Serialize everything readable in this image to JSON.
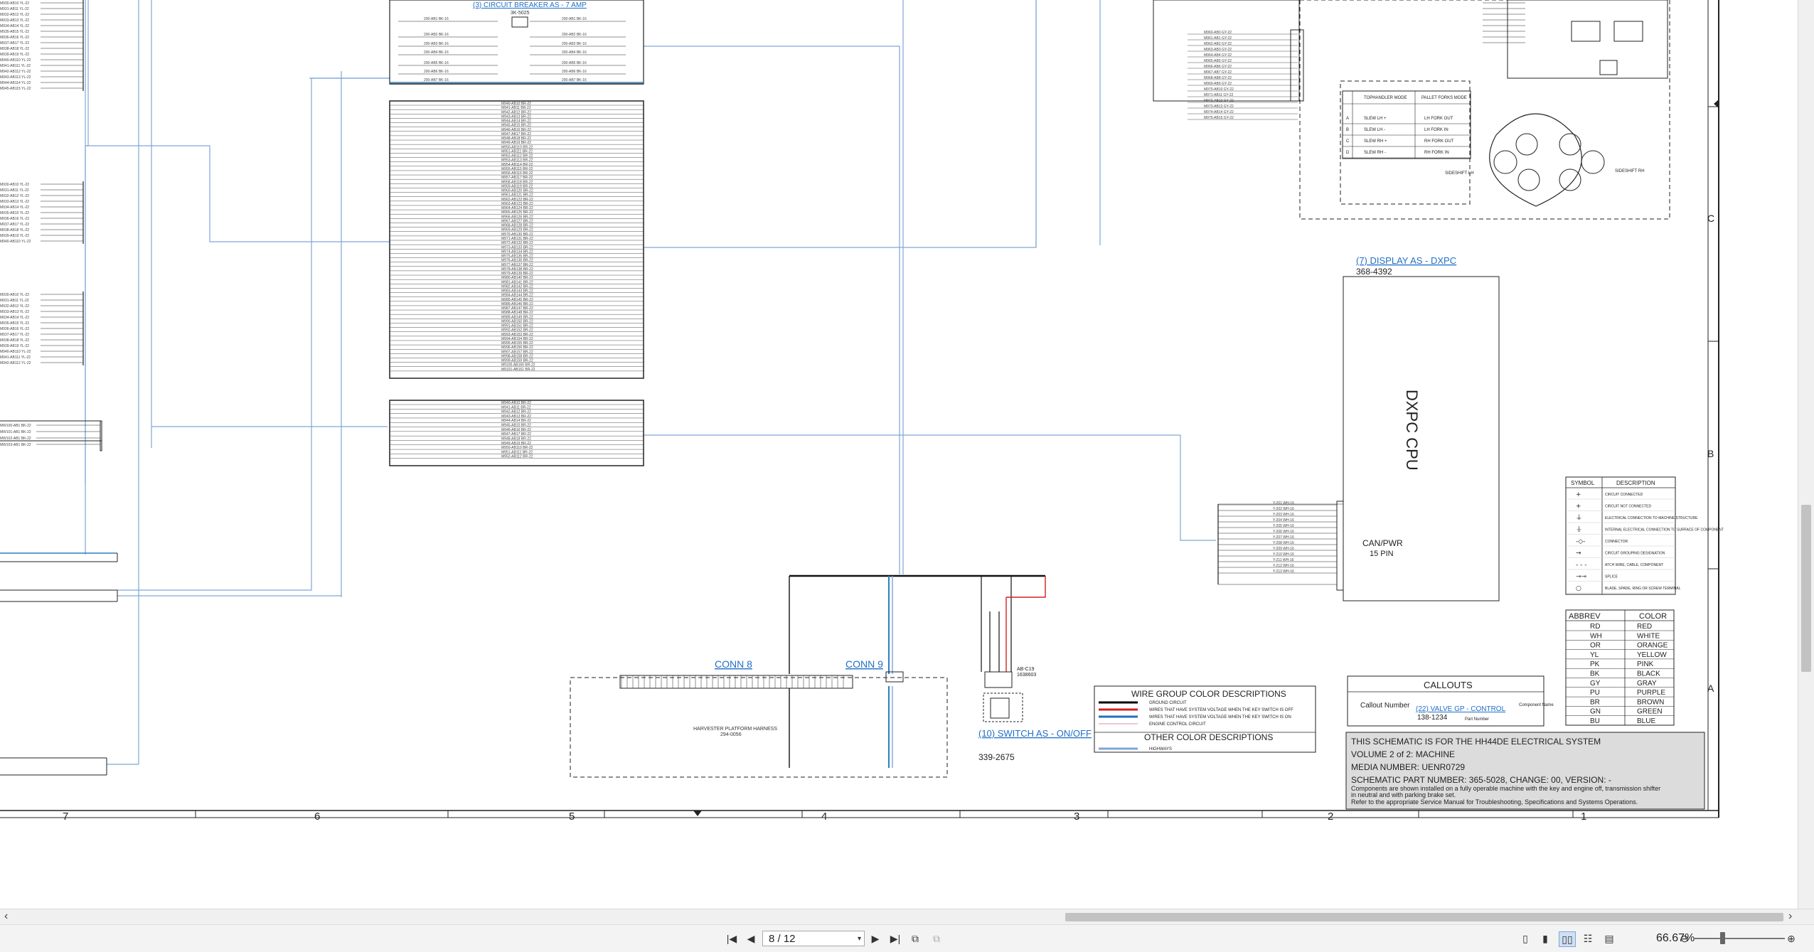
{
  "breaker": {
    "title": "(3) CIRCUIT BREAKER AS - 7 AMP",
    "part": "3K-5025"
  },
  "display": {
    "title": "(7) DISPLAY AS - DXPC",
    "part": "368-4392",
    "cpu": "DXPC CPU",
    "conn": "CAN/PWR",
    "pins": "15 PIN"
  },
  "connectors": {
    "conn8": "CONN 8",
    "conn9": "CONN 9",
    "harness": "HARVESTER PLATFORM HARNESS",
    "harness_part": "294-0056"
  },
  "switch": {
    "title": "(10) SWITCH AS - ON/OFF",
    "part": "339-2675",
    "conn": "AB-C19",
    "conn_part": "1638603"
  },
  "wire_group": {
    "title": "WIRE GROUP COLOR DESCRIPTIONS",
    "rows": [
      {
        "label": "GROUND CIRCUIT",
        "color": "#000000"
      },
      {
        "label": "WIRES THAT HAVE SYSTEM VOLTAGE WHEN THE KEY SWITCH IS OFF",
        "color": "#d22020"
      },
      {
        "label": "WIRES THAT HAVE SYSTEM VOLTAGE WHEN THE KEY SWITCH IS ON",
        "color": "#1f6fc6"
      },
      {
        "label": "ENGINE CONTROL CIRCUIT",
        "color": "#e090a0"
      }
    ],
    "other_title": "OTHER COLOR DESCRIPTIONS",
    "other_rows": [
      {
        "label": "HIGHWAYS",
        "color": "#7ea6d6"
      }
    ]
  },
  "callouts": {
    "title": "CALLOUTS",
    "callout_number": "Callout Number",
    "example": "(22) VALVE GP - CONTROL",
    "example_part": "138-1234",
    "component_name": "Component Name",
    "part_number": "Part Number"
  },
  "notes": {
    "line1": "THIS SCHEMATIC IS FOR THE HH44DE ELECTRICAL SYSTEM",
    "line2": "VOLUME 2 of 2: MACHINE",
    "line3": "MEDIA NUMBER: UENR0729",
    "line4": "SCHEMATIC PART NUMBER: 365-5028, CHANGE: 00, VERSION: -",
    "line5": "Components are shown installed on a fully operable machine with the key and engine off, transmission shifter",
    "line6": "in neutral and with parking brake set.",
    "line7": "Refer to the appropriate Service Manual for Troubleshooting, Specifications and Systems Operations."
  },
  "symbols": {
    "header_symbol": "SYMBOL",
    "header_desc": "DESCRIPTION",
    "rows": [
      {
        "sym": "+",
        "desc": "CIRCUIT CONNECTED"
      },
      {
        "sym": "+",
        "desc": "CIRCUIT NOT CONNECTED"
      },
      {
        "sym": "⏚",
        "desc": "ELECTRICAL CONNECTION TO MACHINE STRUCTURE"
      },
      {
        "sym": "⏚",
        "desc": "INTERNAL ELECTRICAL CONNECTION TO SURFACE OF COMPONENT"
      },
      {
        "sym": "-◇-",
        "desc": "CONNECTOR"
      },
      {
        "sym": "→",
        "desc": "CIRCUIT GROUPING DESIGNATION"
      },
      {
        "sym": "- - -",
        "desc": "ATCH WIRE, CABLE, COMPONENT"
      },
      {
        "sym": "⊸⊸",
        "desc": "SPLICE"
      },
      {
        "sym": "○",
        "desc": "BLADE, SPADE, RING OR SCREW TERMINAL"
      }
    ]
  },
  "abbrev": {
    "header_abbrev": "ABBREV",
    "header_color": "COLOR",
    "rows": [
      {
        "a": "RD",
        "c": "RED"
      },
      {
        "a": "WH",
        "c": "WHITE"
      },
      {
        "a": "OR",
        "c": "ORANGE"
      },
      {
        "a": "YL",
        "c": "YELLOW"
      },
      {
        "a": "PK",
        "c": "PINK"
      },
      {
        "a": "BK",
        "c": "BLACK"
      },
      {
        "a": "GY",
        "c": "GRAY"
      },
      {
        "a": "PU",
        "c": "PURPLE"
      },
      {
        "a": "BR",
        "c": "BROWN"
      },
      {
        "a": "GN",
        "c": "GREEN"
      },
      {
        "a": "BU",
        "c": "BLUE"
      }
    ]
  },
  "side_labels": {
    "c": "C",
    "b": "B",
    "a": "A"
  },
  "grid_numbers": [
    "7",
    "6",
    "5",
    "4",
    "3",
    "2",
    "1"
  ],
  "mode_table": {
    "col1": "TOPHANDLER MODE",
    "col2": "PALLET FORKS MODE",
    "rows": [
      {
        "k": "A",
        "v1": "SLEW LH +",
        "v2": "LH FORK OUT"
      },
      {
        "k": "B",
        "v1": "SLEW LH -",
        "v2": "LH FORK IN"
      },
      {
        "k": "C",
        "v1": "SLEW RH +",
        "v2": "RH FORK OUT"
      },
      {
        "k": "D",
        "v1": "SLEW RH -",
        "v2": "RH FORK IN"
      }
    ],
    "sideshift_lh": "SIDESHIFT LH",
    "sideshift_rh": "SIDESHIFT RH"
  },
  "viewer": {
    "page_value": "8 / 12",
    "zoom": "66.67%",
    "accent": "#1f6fc6"
  }
}
